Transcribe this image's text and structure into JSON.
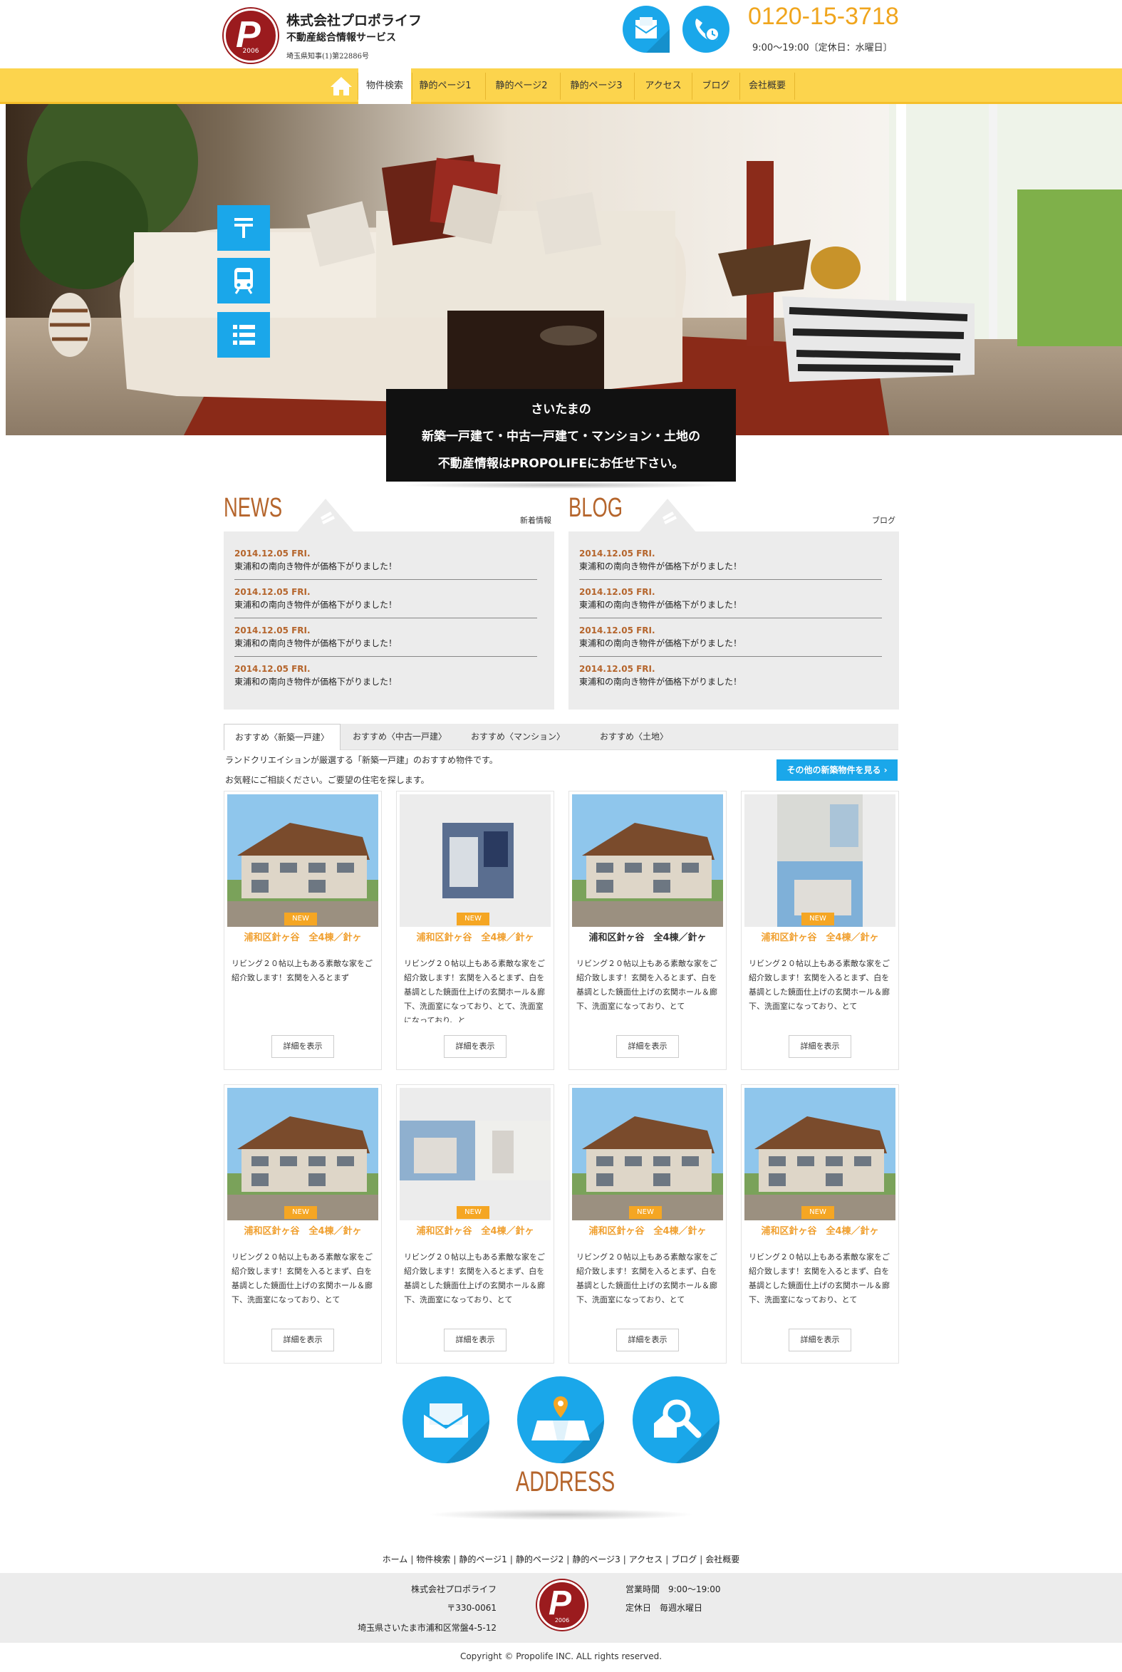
{
  "header": {
    "company": "株式会社プロポライフ",
    "service": "不動産総合情報サービス",
    "license": "埼玉県知事(1)第22886号",
    "logo_year": "2006",
    "phone": "0120-15-3718",
    "hours": "9:00〜19:00〔定休日：水曜日〕",
    "icons": [
      "mail-icon",
      "phone-clock-icon"
    ]
  },
  "nav": {
    "items": [
      "物件検索",
      "静的ページ1",
      "静的ページ2",
      "静的ページ3",
      "アクセス",
      "ブログ",
      "会社概要"
    ]
  },
  "hero": {
    "caption": [
      "さいたまの",
      "新築一戸建て・中古一戸建て・マンション・土地の",
      "不動産情報はPROPOLIFEにお任せ下さい。"
    ]
  },
  "news": {
    "title": "NEWS",
    "subtitle": "新着情報",
    "items": [
      {
        "date": "2014.12.05 FRI.",
        "text": "東浦和の南向き物件が価格下がりました！"
      },
      {
        "date": "2014.12.05 FRI.",
        "text": "東浦和の南向き物件が価格下がりました！"
      },
      {
        "date": "2014.12.05 FRI.",
        "text": "東浦和の南向き物件が価格下がりました！"
      },
      {
        "date": "2014.12.05 FRI.",
        "text": "東浦和の南向き物件が価格下がりました！"
      }
    ]
  },
  "blog": {
    "title": "BLOG",
    "subtitle": "ブログ",
    "items": [
      {
        "date": "2014.12.05 FRI.",
        "text": "東浦和の南向き物件が価格下がりました！"
      },
      {
        "date": "2014.12.05 FRI.",
        "text": "東浦和の南向き物件が価格下がりました！"
      },
      {
        "date": "2014.12.05 FRI.",
        "text": "東浦和の南向き物件が価格下がりました！"
      },
      {
        "date": "2014.12.05 FRI.",
        "text": "東浦和の南向き物件が価格下がりました！"
      }
    ]
  },
  "tabs": [
    "おすすめ〈新築一戸建〉",
    "おすすめ〈中古一戸建〉",
    "おすすめ〈マンション〉",
    "おすすめ〈土地〉"
  ],
  "intro": [
    "ランドクリエイションが厳選する「新築一戸建」のおすすめ物件です。",
    "お気軽にご相談ください。ご要望の住宅を探します。"
  ],
  "more_button": "その他の新築物件を見る ›",
  "cards": [
    {
      "badge": "NEW",
      "title": "浦和区針ヶ谷　全4棟／針ヶ",
      "desc": "リビング２０帖以上もある素敵な家をご紹介致します！玄関を入るとまず",
      "button": "詳細を表示"
    },
    {
      "badge": "NEW",
      "title": "浦和区針ヶ谷　全4棟／針ヶ",
      "desc": "リビング２０帖以上もある素敵な家をご紹介致します！玄関を入るとまず、白を基調とした鏡面仕上げの玄関ホール＆廊下、洗面室になっており、とて、洗面室になっており、と",
      "button": "詳細を表示"
    },
    {
      "badge": "",
      "title": "浦和区針ヶ谷　全4棟／針ヶ",
      "desc": "リビング２０帖以上もある素敵な家をご紹介致します！玄関を入るとまず、白を基調とした鏡面仕上げの玄関ホール＆廊下、洗面室になっており、とて",
      "button": "詳細を表示"
    },
    {
      "badge": "NEW",
      "title": "浦和区針ヶ谷　全4棟／針ヶ",
      "desc": "リビング２０帖以上もある素敵な家をご紹介致します！玄関を入るとまず、白を基調とした鏡面仕上げの玄関ホール＆廊下、洗面室になっており、とて",
      "button": "詳細を表示"
    },
    {
      "badge": "NEW",
      "title": "浦和区針ヶ谷　全4棟／針ヶ",
      "desc": "リビング２０帖以上もある素敵な家をご紹介致します！玄関を入るとまず、白を基調とした鏡面仕上げの玄関ホール＆廊下、洗面室になっており、とて",
      "button": "詳細を表示"
    },
    {
      "badge": "NEW",
      "title": "浦和区針ヶ谷　全4棟／針ヶ",
      "desc": "リビング２０帖以上もある素敵な家をご紹介致します！玄関を入るとまず、白を基調とした鏡面仕上げの玄関ホール＆廊下、洗面室になっており、とて",
      "button": "詳細を表示"
    },
    {
      "badge": "NEW",
      "title": "浦和区針ヶ谷　全4棟／針ヶ",
      "desc": "リビング２０帖以上もある素敵な家をご紹介致します！玄関を入るとまず、白を基調とした鏡面仕上げの玄関ホール＆廊下、洗面室になっており、とて",
      "button": "詳細を表示"
    },
    {
      "badge": "NEW",
      "title": "浦和区針ヶ谷　全4棟／針ヶ",
      "desc": "リビング２０帖以上もある素敵な家をご紹介致します！玄関を入るとまず、白を基調とした鏡面仕上げの玄関ホール＆廊下、洗面室になっており、とて",
      "button": "詳細を表示"
    }
  ],
  "address": {
    "title": "ADDRESS"
  },
  "footer_nav": [
    "ホーム",
    "物件検索",
    "静的ページ1",
    "静的ページ2",
    "静的ページ3",
    "アクセス",
    "ブログ",
    "会社概要"
  ],
  "footer": {
    "company": "株式会社プロポライフ",
    "zip": "〒330-0061",
    "address": "埼玉県さいたま市浦和区常盤4-5-12",
    "hours": "営業時間　9:00〜19:00",
    "holiday": "定休日　毎週水曜日",
    "logo_year": "2006"
  },
  "copyright": "Copyright © Propolife INC. ALL rights reserved.",
  "colors": {
    "accent": "#1aa7ea",
    "nav": "#fcd44d",
    "brand": "#9b1b1e",
    "title": "#b5652c",
    "orange": "#f0a51d"
  }
}
